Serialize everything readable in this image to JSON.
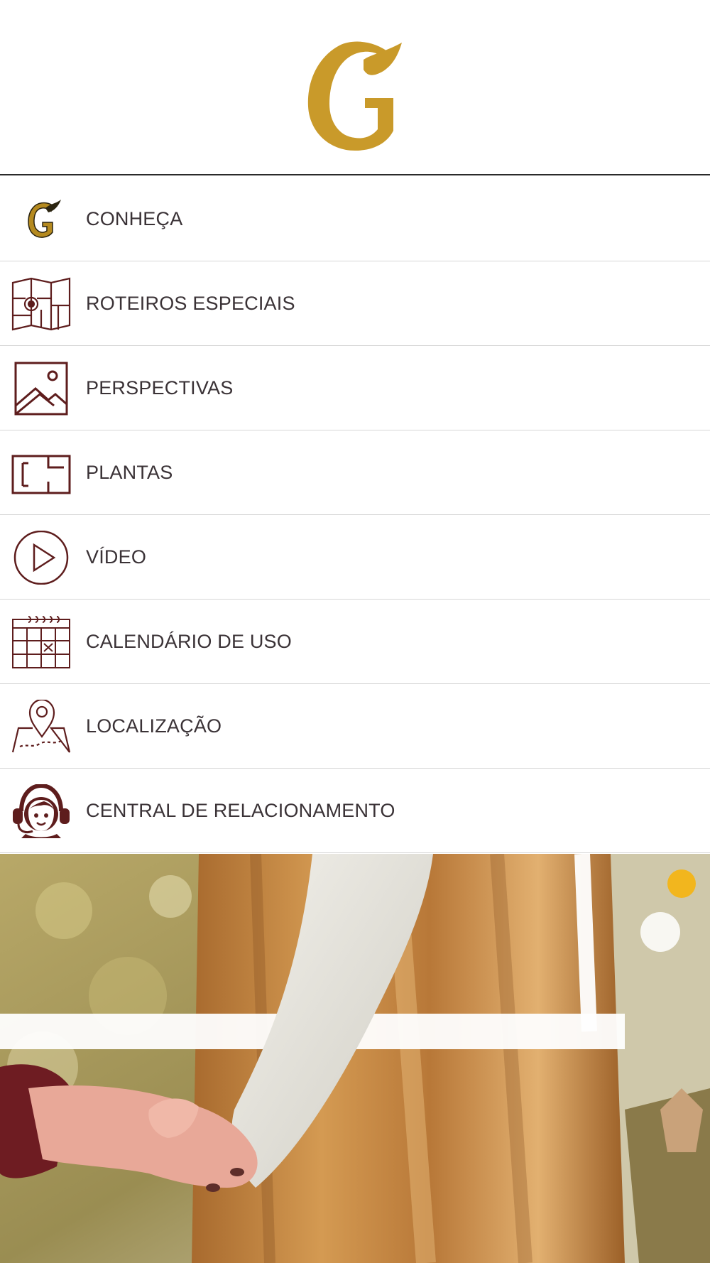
{
  "header": {
    "logo_icon": "g-fox-logo-icon"
  },
  "colors": {
    "accent": "#c99a2a",
    "icon": "#5e1d1d",
    "text": "#3a3236",
    "divider": "#d6d6d6"
  },
  "menu": {
    "items": [
      {
        "label": "CONHEÇA",
        "icon": "g-logo-icon"
      },
      {
        "label": "ROTEIROS ESPECIAIS",
        "icon": "map-icon"
      },
      {
        "label": "PERSPECTIVAS",
        "icon": "image-icon"
      },
      {
        "label": "PLANTAS",
        "icon": "floor-plan-icon"
      },
      {
        "label": "VÍDEO",
        "icon": "play-icon"
      },
      {
        "label": "CALENDÁRIO DE USO",
        "icon": "calendar-icon"
      },
      {
        "label": "LOCALIZAÇÃO",
        "icon": "location-pin-icon"
      },
      {
        "label": "CENTRAL DE RELACIONAMENTO",
        "icon": "headset-agent-icon"
      }
    ]
  },
  "banner": {
    "image": "winter-wedding-photo"
  }
}
